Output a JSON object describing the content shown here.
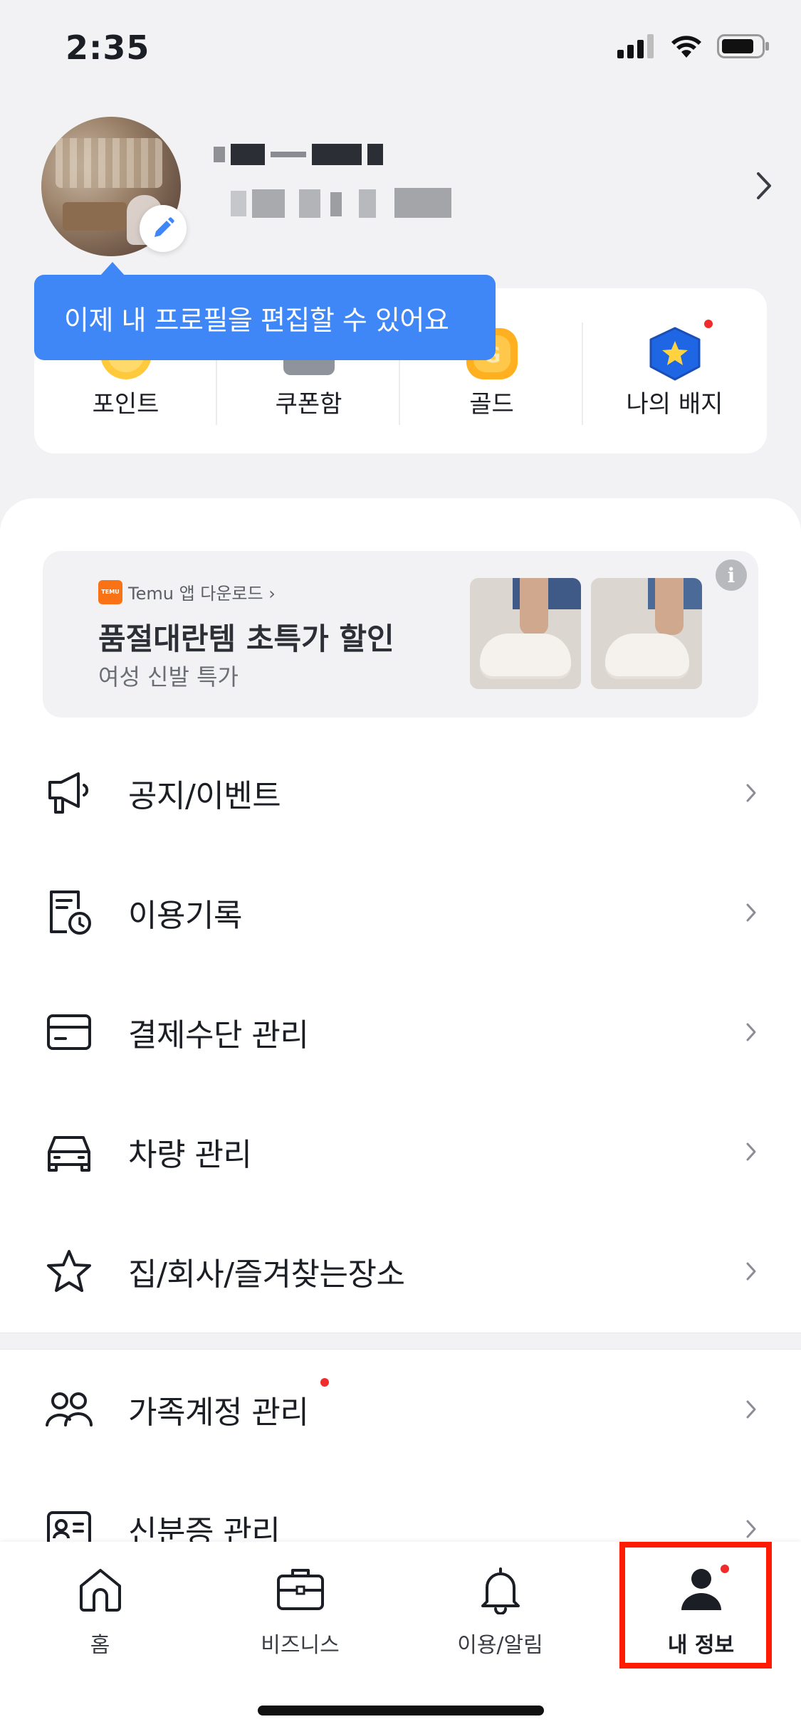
{
  "status_bar": {
    "time": "2:35"
  },
  "profile": {
    "tooltip": "이제 내 프로필을 편집할 수 있어요"
  },
  "stats": [
    {
      "label": "포인트",
      "icon": "point-coin-icon"
    },
    {
      "label": "쿠폰함",
      "icon": "coupon-icon"
    },
    {
      "label": "골드",
      "icon": "gold-icon"
    },
    {
      "label": "나의 배지",
      "icon": "badge-star-icon"
    }
  ],
  "promo": {
    "brand": "Temu 앱 다운로드 ›",
    "logo_text": "TEMU",
    "title": "품절대란템 초특가 할인",
    "subtitle": "여성 신발 특가",
    "info": "i"
  },
  "menu": [
    {
      "label": "공지/이벤트",
      "icon": "megaphone-icon"
    },
    {
      "label": "이용기록",
      "icon": "history-document-icon"
    },
    {
      "label": "결제수단 관리",
      "icon": "credit-card-icon"
    },
    {
      "label": "차량 관리",
      "icon": "car-icon"
    },
    {
      "label": "집/회사/즐겨찾는장소",
      "icon": "star-icon"
    },
    {
      "label": "가족계정 관리",
      "icon": "family-icon"
    },
    {
      "label": "신분증 관리",
      "icon": "id-card-icon"
    }
  ],
  "bottom_nav": [
    {
      "label": "홈",
      "icon": "home-icon"
    },
    {
      "label": "비즈니스",
      "icon": "briefcase-icon"
    },
    {
      "label": "이용/알림",
      "icon": "bell-icon"
    },
    {
      "label": "내 정보",
      "icon": "person-icon",
      "active": true
    }
  ],
  "colors": {
    "accent_blue": "#3f86f7",
    "notification_red": "#f12b2b",
    "highlight_red": "#ff1a00"
  }
}
